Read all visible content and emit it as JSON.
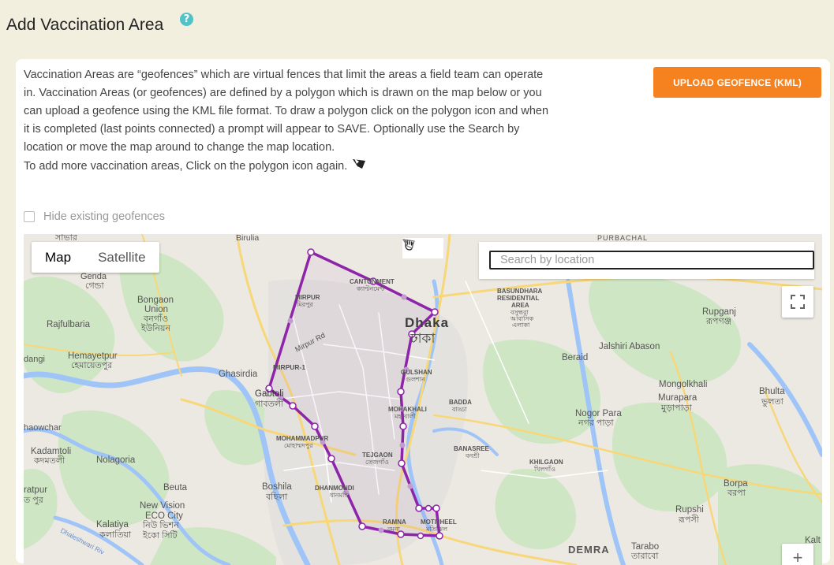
{
  "page": {
    "title": "Add Vaccination Area",
    "help_icon": "question-circle-icon"
  },
  "description": {
    "paragraph1": "Vaccination Areas are “geofences” which are virtual fences that limit the areas a field team can operate in. Vaccination Areas (or geofences) are defined by a polygon which is drawn on the map below or you can upload a geofence using the KML file format. To draw a polygon click on the polygon icon and when it is completed (last points connected) a prompt will appear to SAVE. Optionally use the Search by location or move the map around to change the map location.",
    "paragraph2": "To add more vaccination areas, Click on the polygon icon again."
  },
  "upload_button": {
    "label": "UPLOAD GEOFENCE (KML)",
    "color": "#f5821f"
  },
  "hide_geofences": {
    "label": "Hide existing geofences",
    "checked": false
  },
  "map": {
    "type_buttons": [
      {
        "label": "Map",
        "active": true
      },
      {
        "label": "Satellite",
        "active": false
      }
    ],
    "search_placeholder": "Search by location",
    "polygon_color": "#8e24aa",
    "labels": {
      "birulia": "Birulia",
      "purbachal": "PURBACHAL",
      "genda_en": "Genda",
      "genda_bn": "গেন্ডা",
      "bongaon_en": "Bongaon",
      "bongaon_union": "Union",
      "bongaon_bn1": "বনগাঁও",
      "bongaon_bn2": "ইউনিয়ন",
      "rajfulbaria": "Rajfulbaria",
      "hemayetpur_en": "Hemayetpur",
      "hemayetpur_bn": "হেমায়েতপুর",
      "dangi": "dangi",
      "cantonment_en": "CANTONMENT",
      "cantonment_bn": "ক্যান্টনমেন্ট",
      "mirpur_en": "MIRPUR",
      "mirpur_bn": "মিরপুর",
      "mirpur_rd": "Mirpur Rd",
      "mirpur1": "MIRPUR-1",
      "ghasirdia": "Ghasirdia",
      "gabtoli_en": "Gabtoli",
      "gabtoli_bn": "গাবতলী",
      "dhaka_en": "Dhaka",
      "dhaka_bn": "ঢাকা",
      "gulshan_en": "GULSHAN",
      "gulshan_bn": "গুলশান",
      "bashundhara1": "BASUNDHARA",
      "bashundhara2": "RESIDENTIAL",
      "bashundhara3": "AREA",
      "bashundhara_bn1": "বসুন্ধরা",
      "bashundhara_bn2": "আবাসিক",
      "bashundhara_bn3": "এলাকা",
      "rupganj_en": "Rupganj",
      "rupganj_bn": "রূপগঞ্জ",
      "jalshiri": "Jalshiri Abason",
      "beraid": "Beraid",
      "mongolkhali": "Mongolkhali",
      "murapara_en": "Murapara",
      "murapara_bn": "মুড়াপাড়া",
      "bhulta_en": "Bhulta",
      "bhulta_bn": "ভুলতা",
      "mohakhali_en": "MOHAKHALI",
      "mohakhali_bn": "মহাখালী",
      "badda_en": "BADDA",
      "badda_bn": "বাড্ডা",
      "nogor_en": "Nogor Para",
      "nogor_bn": "নগর পাড়া",
      "haowchar": "haowchar",
      "mohammadpur_en": "MOHAMMADPUR",
      "mohammadpur_bn": "মোহাম্মদপুর",
      "tejgaon_en": "TEJGAON",
      "tejgaon_bn": "তেজগাঁও",
      "banasree_en": "BANASREE",
      "banasree_bn": "বনশ্রী",
      "khilgaon_en": "KHILGAON",
      "khilgaon_bn": "খিলগাঁও",
      "kadamtoli_en": "Kadamtoli",
      "kadamtoli_bn": "কদমতলী",
      "nolagoria": "Nolagoria",
      "ratpur_en": "ratpur",
      "ratpur_bn": "ত পুর",
      "beuta": "Beuta",
      "boshila_en": "Boshila",
      "boshila_bn": "বছিলা",
      "dhanmondi_en": "DHANMONDI",
      "dhanmondi_bn": "ধানমন্ডি",
      "borpa_en": "Borpa",
      "borpa_bn": "বরপা",
      "newvision1": "New Vision",
      "newvision2": "ECO City",
      "newvision_bn1": "নিউ ভিশন",
      "newvision_bn2": "ইকো সিটি",
      "kalatiya_en": "Kalatiya",
      "kalatiya_bn": "কলাতিয়া",
      "ramna_en": "RAMNA",
      "ramna_bn": "রমনা",
      "motijheel_en": "MOTIJHEEL",
      "motijheel_bn": "মতিঝিল",
      "rupshi_en": "Rupshi",
      "rupshi_bn": "রূপসী",
      "demra": "DEMRA",
      "tarabo_en": "Tarabo",
      "tarabo_bn": "তারাবো",
      "kalt": "Kalt",
      "dhaleshwari": "Dhaleshwari Riv",
      "savar_bn": "সাভার"
    }
  }
}
